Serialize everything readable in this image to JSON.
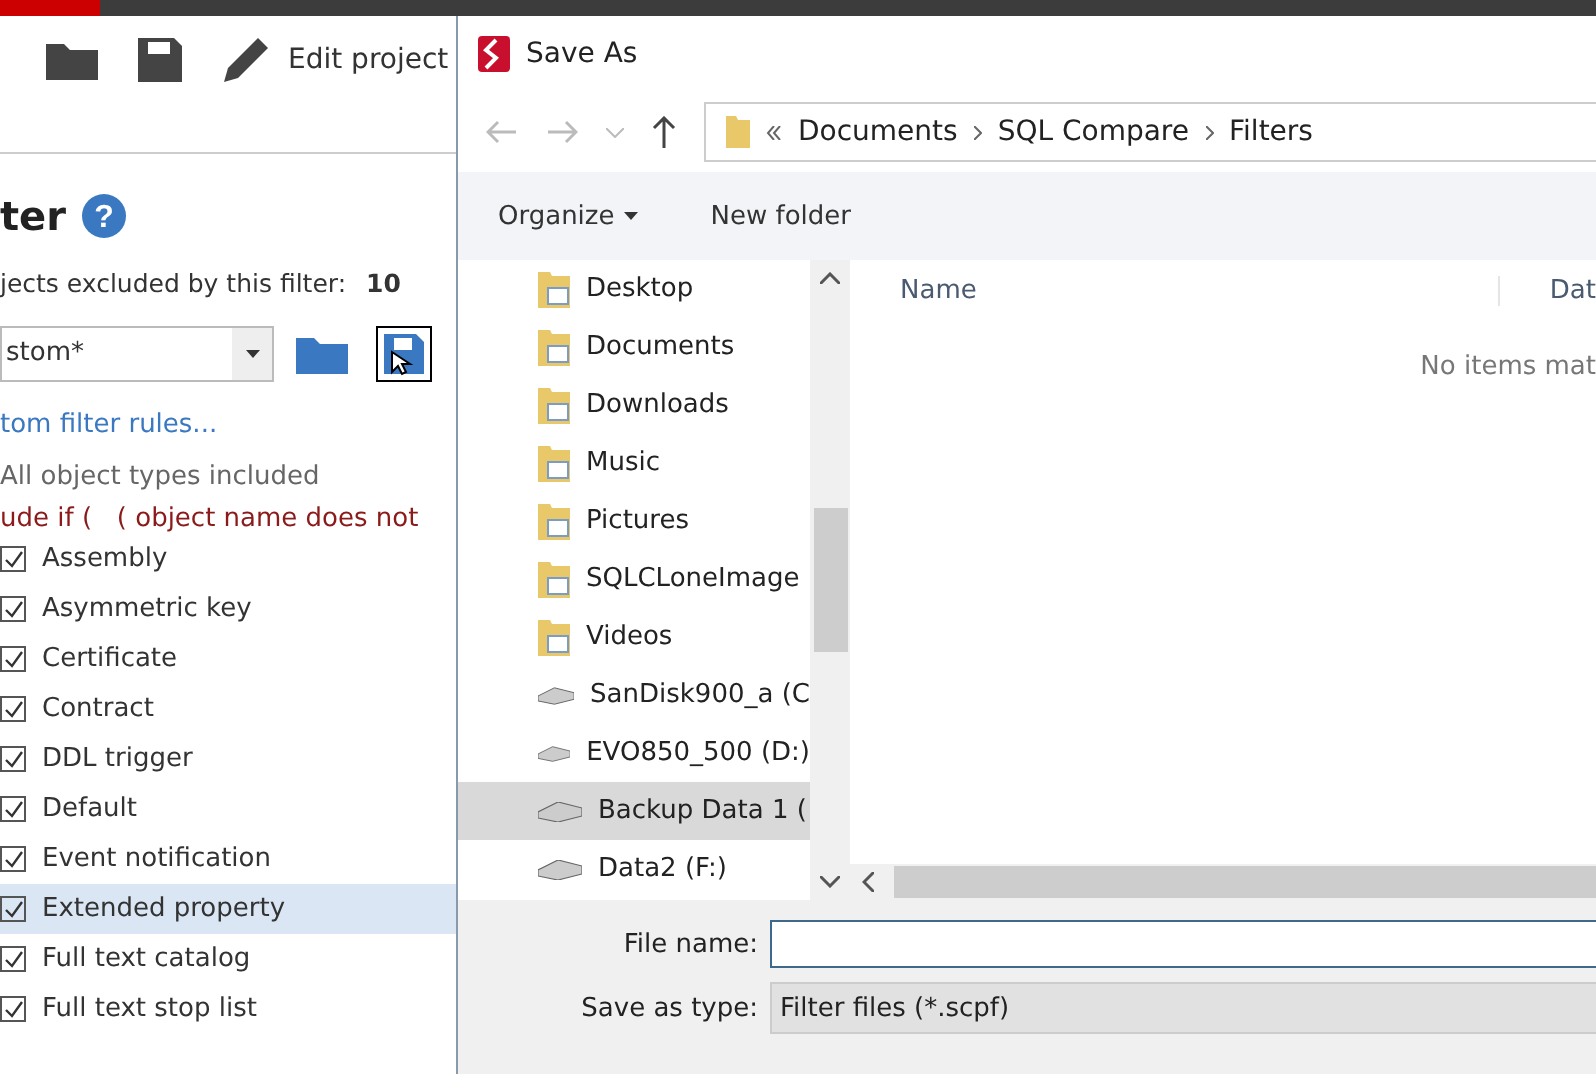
{
  "app": {
    "toolbar": {
      "edit_project": "Edit project"
    },
    "filter": {
      "heading": "ter",
      "help": "?",
      "excluded_label": "jects excluded by this filter:",
      "excluded_count": "10",
      "preset": "stom*",
      "link": "tom filter rules...",
      "summary": "All object types included",
      "rule": "ude if (   ( object name does not",
      "types": [
        {
          "label": "Assembly",
          "checked": true,
          "selected": false
        },
        {
          "label": "Asymmetric key",
          "checked": true,
          "selected": false
        },
        {
          "label": "Certificate",
          "checked": true,
          "selected": false
        },
        {
          "label": "Contract",
          "checked": true,
          "selected": false
        },
        {
          "label": "DDL trigger",
          "checked": true,
          "selected": false
        },
        {
          "label": "Default",
          "checked": true,
          "selected": false
        },
        {
          "label": "Event notification",
          "checked": true,
          "selected": false
        },
        {
          "label": "Extended property",
          "checked": true,
          "selected": true
        },
        {
          "label": "Full text catalog",
          "checked": true,
          "selected": false
        },
        {
          "label": "Full text stop list",
          "checked": true,
          "selected": false
        }
      ]
    }
  },
  "dialog": {
    "title": "Save As",
    "breadcrumb": [
      "Documents",
      "SQL Compare",
      "Filters"
    ],
    "toolbar": {
      "organize": "Organize",
      "new_folder": "New folder"
    },
    "nav": [
      {
        "label": "Desktop",
        "kind": "folder",
        "selected": false
      },
      {
        "label": "Documents",
        "kind": "folder",
        "selected": false
      },
      {
        "label": "Downloads",
        "kind": "folder",
        "selected": false
      },
      {
        "label": "Music",
        "kind": "folder",
        "selected": false
      },
      {
        "label": "Pictures",
        "kind": "folder",
        "selected": false
      },
      {
        "label": "SQLCLoneImage",
        "kind": "folder",
        "selected": false
      },
      {
        "label": "Videos",
        "kind": "folder",
        "selected": false
      },
      {
        "label": "SanDisk900_a (C",
        "kind": "drive",
        "selected": false
      },
      {
        "label": "EVO850_500 (D:)",
        "kind": "drive",
        "selected": false
      },
      {
        "label": "Backup Data 1 (",
        "kind": "drive",
        "selected": true
      },
      {
        "label": "Data2 (F:)",
        "kind": "drive",
        "selected": false
      }
    ],
    "columns": [
      "Name",
      "Dat"
    ],
    "empty": "No items mat",
    "file_name": {
      "label": "File name:"
    },
    "save_type": {
      "label": "Save as type:",
      "value": "Filter files (*.scpf)"
    }
  }
}
